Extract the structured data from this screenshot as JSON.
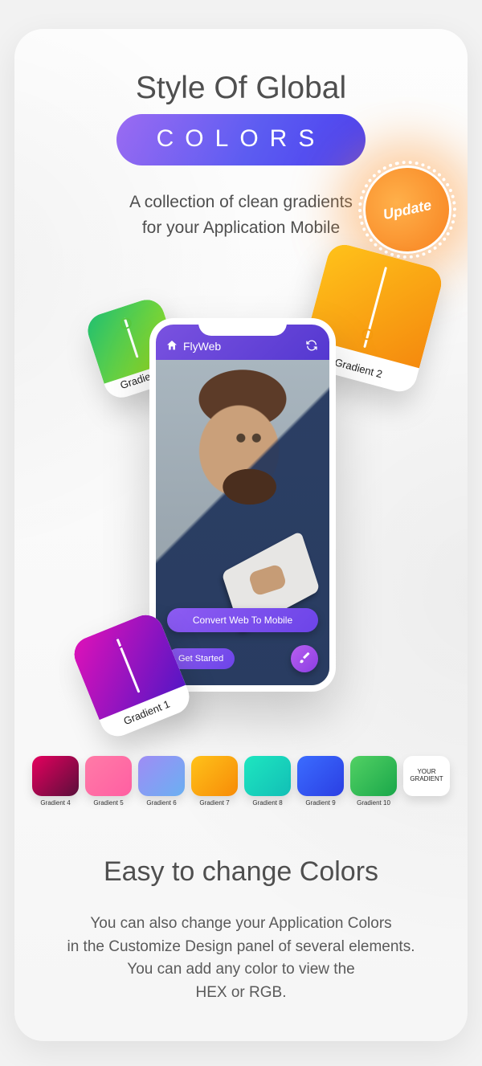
{
  "header": {
    "title": "Style Of Global",
    "pill_label": "COLORS",
    "subtitle_line1": "A collection of clean gradients",
    "subtitle_line2": "for your Application Mobile",
    "badge": "Update"
  },
  "phone": {
    "app_name": "FlyWeb",
    "cta_primary": "Convert Web To Mobile",
    "cta_secondary": "Get Started"
  },
  "chips": [
    {
      "label": "Gradient 1"
    },
    {
      "label": "Gradient 2"
    },
    {
      "label": "Gradient 3"
    }
  ],
  "swatches": [
    {
      "label": "Gradient 4",
      "from": "#e5005e",
      "to": "#5a0f3b"
    },
    {
      "label": "Gradient 5",
      "from": "#ff7ba7",
      "to": "#ff5fa2"
    },
    {
      "label": "Gradient 6",
      "from": "#9f8cf5",
      "to": "#6ab0f2"
    },
    {
      "label": "Gradient 7",
      "from": "#ffc21a",
      "to": "#f78b07"
    },
    {
      "label": "Gradient 8",
      "from": "#1ee6c0",
      "to": "#12bfb6"
    },
    {
      "label": "Gradient 9",
      "from": "#3b6cff",
      "to": "#2b3fe3"
    },
    {
      "label": "Gradient 10",
      "from": "#52d164",
      "to": "#1aa74a"
    }
  ],
  "swatch_last": "YOUR\nGRADIENT",
  "footer": {
    "heading": "Easy to change Colors",
    "body_l1": "You can also change your Application Colors",
    "body_l2": "in the Customize Design panel of several elements.",
    "body_l3": "You can add any color to view the",
    "body_l4": "HEX or RGB."
  }
}
